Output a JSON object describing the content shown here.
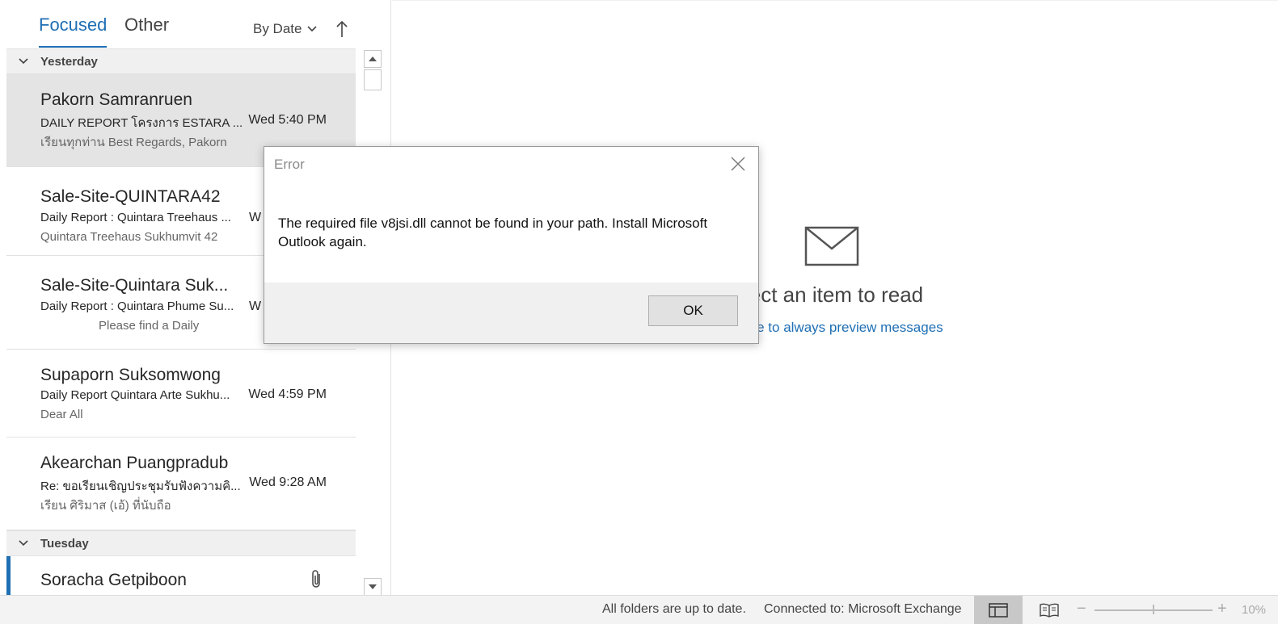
{
  "tabs": {
    "focused": "Focused",
    "other": "Other"
  },
  "sort": {
    "label": "By Date"
  },
  "groups": {
    "yesterday": "Yesterday",
    "tuesday": "Tuesday"
  },
  "messages": [
    {
      "sender": "Pakorn Samranruen",
      "subject": "DAILY REPORT โครงการ ESTARA ...",
      "preview": "เรียนทุกท่าน  Best Regards,  Pakorn",
      "time": "Wed 5:40 PM"
    },
    {
      "sender": "Sale-Site-QUINTARA42",
      "subject": "Daily Report : Quintara Treehaus ...",
      "preview": "Quintara Treehaus Sukhumvit 42",
      "time": "W"
    },
    {
      "sender": "Sale-Site-Quintara Suk...",
      "subject": "Daily Report : Quintara Phume Su...",
      "preview": "Please find a Daily",
      "time": "W"
    },
    {
      "sender": "Supaporn Suksomwong",
      "subject": "Daily Report Quintara Arte Sukhu...",
      "preview": "Dear All",
      "time": "Wed 4:59 PM"
    },
    {
      "sender": "Akearchan Puangpradub",
      "subject": "Re: ขอเรียนเชิญประชุมรับฟังความคิ...",
      "preview": "เรียน ศิริมาส (เอ้) ที่นับถือ",
      "time": "Wed 9:28 AM"
    },
    {
      "sender": "Soracha Getpiboon"
    }
  ],
  "reading_pane": {
    "title": "lect an item to read",
    "link": "ere to always preview messages"
  },
  "status_bar": {
    "up_to_date": "All folders are up to date.",
    "connected": "Connected to: Microsoft Exchange",
    "zoom": "10%"
  },
  "dialog": {
    "title": "Error",
    "message": "The required file v8jsi.dll cannot be found in your path. Install Microsoft Outlook again.",
    "ok_label": "OK"
  },
  "colors": {
    "accent": "#1f6fb4",
    "selected_row": "#e4e4e4",
    "group_header": "#f0f0f0"
  }
}
